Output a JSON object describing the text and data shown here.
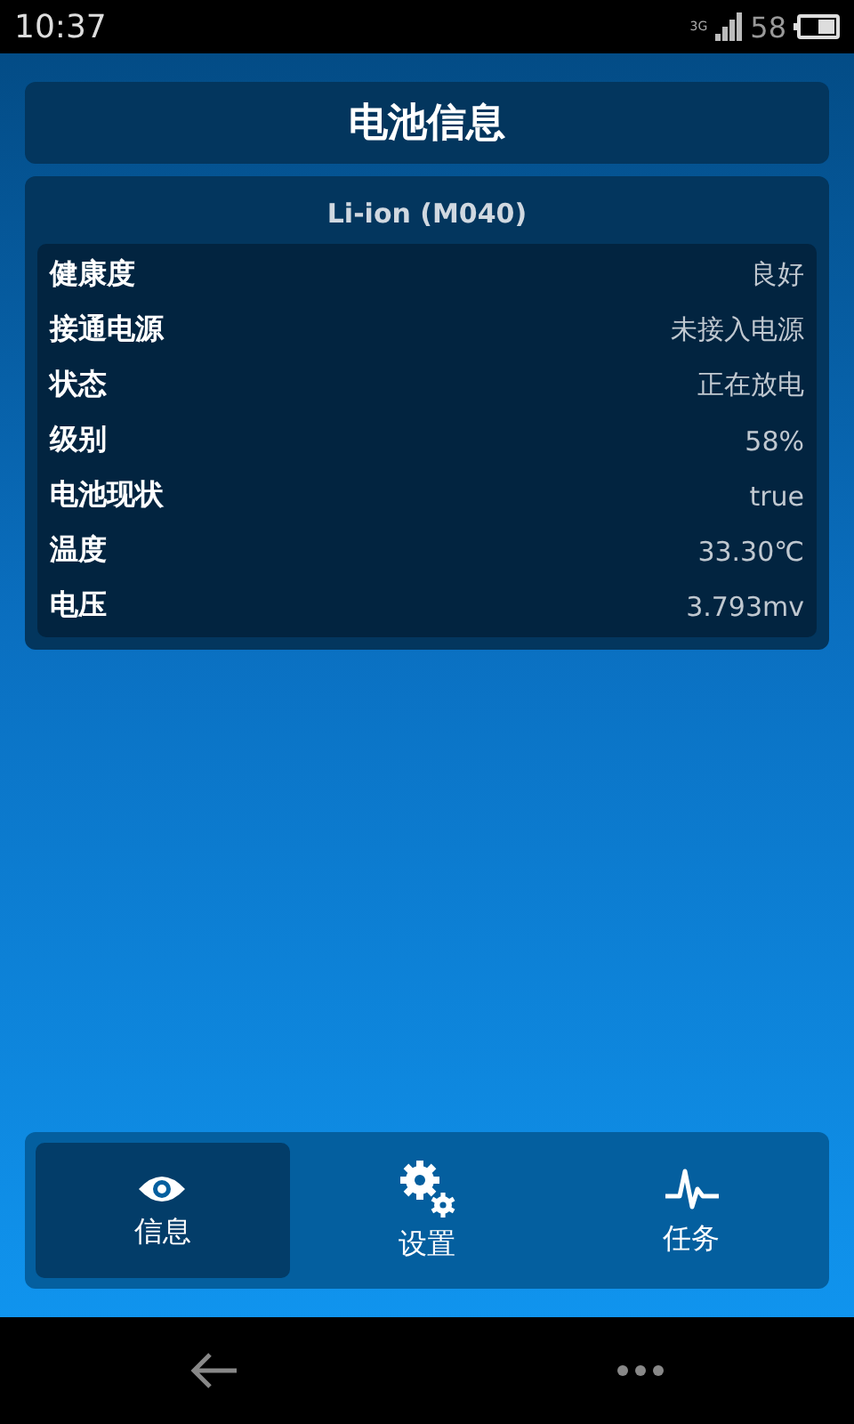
{
  "status_bar": {
    "time": "10:37",
    "network": "3G",
    "battery": "58"
  },
  "title": "电池信息",
  "battery_card": {
    "model": "Li-ion (M040)",
    "rows": [
      {
        "label": "健康度",
        "value": "良好"
      },
      {
        "label": "接通电源",
        "value": "未接入电源"
      },
      {
        "label": "状态",
        "value": "正在放电"
      },
      {
        "label": "级别",
        "value": "58%"
      },
      {
        "label": "电池现状",
        "value": "true"
      },
      {
        "label": "温度",
        "value": "33.30℃"
      },
      {
        "label": "电压",
        "value": "3.793mv"
      }
    ]
  },
  "tabs": [
    {
      "label": "信息",
      "kind": "eye",
      "selected": true
    },
    {
      "label": "设置",
      "kind": "gears",
      "selected": false
    },
    {
      "label": "任务",
      "kind": "pulse",
      "selected": false
    }
  ]
}
